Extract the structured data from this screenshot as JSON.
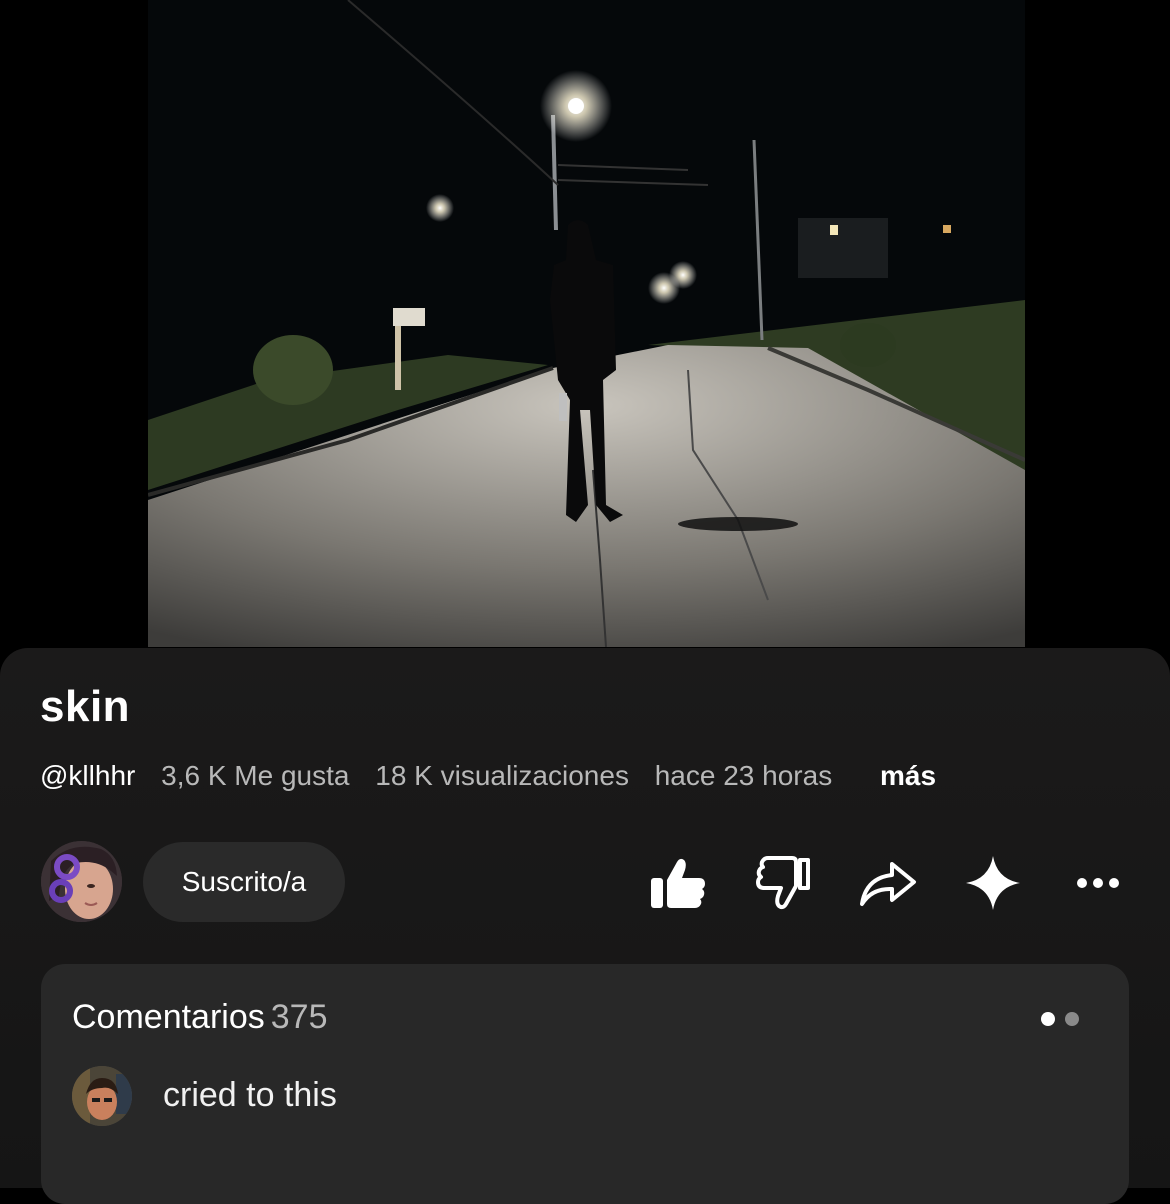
{
  "video": {
    "title": "skin",
    "channel": "@kllhhr",
    "likes": "3,6 K Me gusta",
    "views": "18 K visualizaciones",
    "age": "hace 23 horas",
    "more_label": "más"
  },
  "actions": {
    "subscribe_label": "Suscrito/a",
    "icons": [
      "thumbs-up-icon",
      "thumbs-down-icon",
      "share-icon",
      "remix-sparkle-icon",
      "more-horizontal-icon"
    ]
  },
  "comments": {
    "label": "Comentarios",
    "count": "375",
    "first_comment": "cried to this"
  },
  "colors": {
    "sheet_bg": "#1b1a1a",
    "button_bg": "#2a2a2a",
    "comments_bg": "#282828",
    "muted_text": "#b8b8b8"
  }
}
